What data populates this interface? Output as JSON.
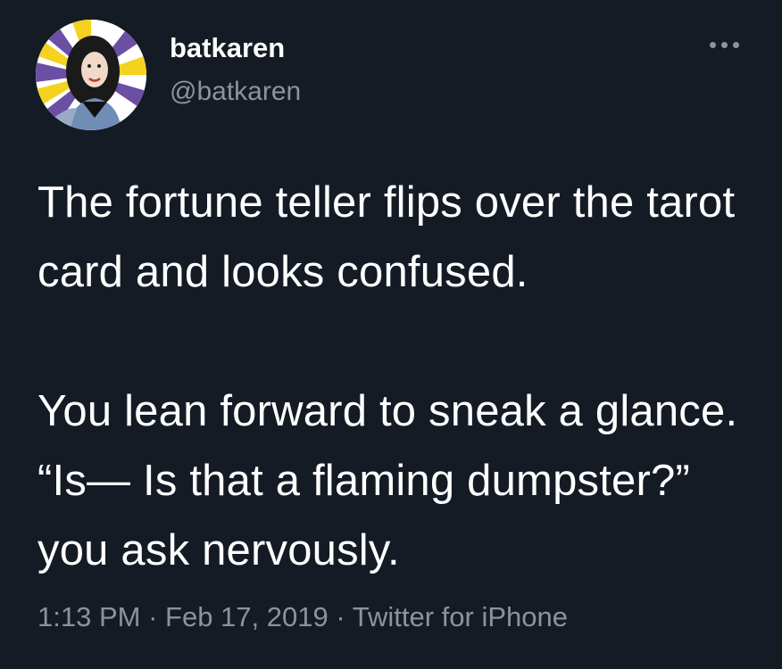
{
  "tweet": {
    "author": {
      "display_name": "batkaren",
      "handle": "@batkaren",
      "avatar_icon": "avatar-illustration"
    },
    "menu_icon": "more-options-icon",
    "paragraphs": [
      "The fortune teller flips over the tarot card and looks confused.",
      "You lean forward to sneak a glance. “Is— Is that a flaming dumpster?” you ask nervously."
    ],
    "time": "1:13 PM",
    "separator": "·",
    "date": "Feb 17, 2019",
    "source": "Twitter for iPhone"
  },
  "colors": {
    "background": "#151b25",
    "text": "#ffffff",
    "secondary_text": "#8a939e",
    "avatar_accent_yellow": "#f4d21f",
    "avatar_accent_purple": "#6a4fa3"
  }
}
